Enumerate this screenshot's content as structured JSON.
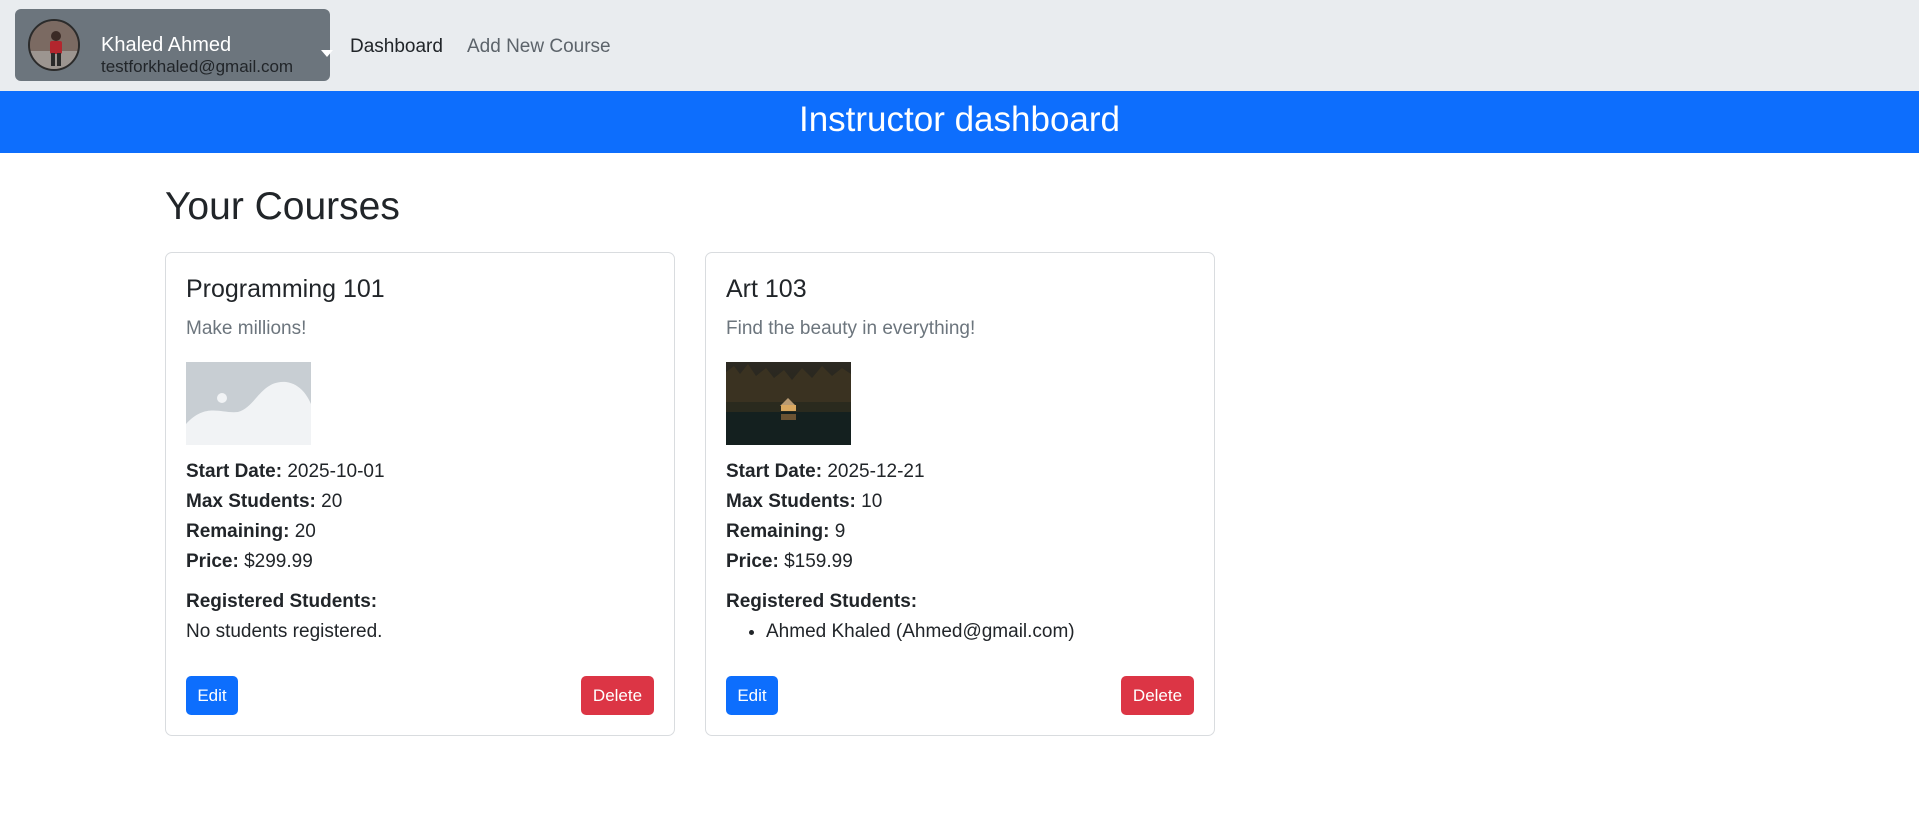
{
  "user": {
    "name": "Khaled Ahmed",
    "email": "testforkhaled@gmail.com",
    "avatar_icon": "user-avatar"
  },
  "nav": {
    "dashboard_label": "Dashboard",
    "add_course_label": "Add New Course"
  },
  "banner": {
    "title": "Instructor dashboard"
  },
  "main": {
    "heading": "Your Courses"
  },
  "labels": {
    "start_date": "Start Date:",
    "max_students": "Max Students:",
    "remaining": "Remaining:",
    "price": "Price:",
    "registered_students": "Registered Students:",
    "edit": "Edit",
    "delete": "Delete"
  },
  "courses": [
    {
      "title": "Programming 101",
      "subtitle": "Make millions!",
      "image": "placeholder-image-icon",
      "start_date": "2025-10-01",
      "max_students": "20",
      "remaining": "20",
      "price": "$299.99",
      "no_students_text": "No students registered.",
      "students": []
    },
    {
      "title": "Art 103",
      "subtitle": "Find the beauty in everything!",
      "image": "lake-cabin-photo",
      "start_date": "2025-12-21",
      "max_students": "10",
      "remaining": "9",
      "price": "$159.99",
      "students": [
        "Ahmed Khaled (Ahmed@gmail.com)"
      ]
    }
  ],
  "colors": {
    "navbar_bg": "#e9ecef",
    "user_box_bg": "#6c757d",
    "primary": "#0d6efd",
    "danger": "#dc3545"
  }
}
